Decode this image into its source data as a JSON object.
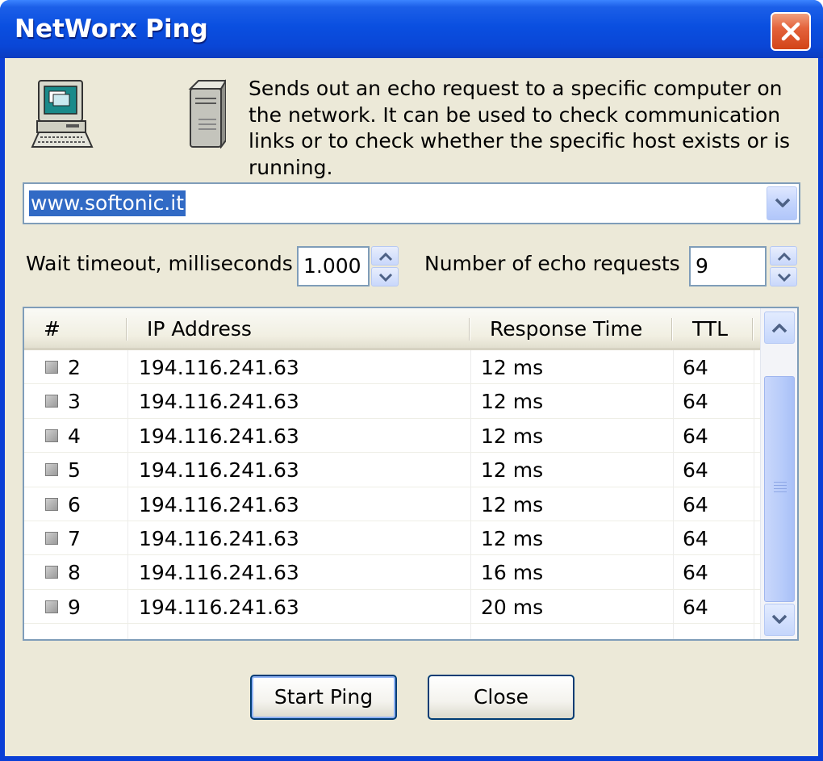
{
  "window": {
    "title": "NetWorx Ping",
    "close_icon": "close-icon"
  },
  "description": "Sends out an echo request to a specific computer on the network. It can be used to check communication links or to check whether the specific host exists or is running.",
  "host_combo": {
    "value": "www.softonic.it"
  },
  "settings": {
    "timeout_label": "Wait timeout, milliseconds",
    "timeout_value": "1.000",
    "count_label": "Number of echo requests",
    "count_value": "9"
  },
  "results": {
    "columns": [
      "#",
      "IP Address",
      "Response Time",
      "TTL"
    ],
    "rows": [
      {
        "num": "2",
        "ip": "194.116.241.63",
        "time": "12 ms",
        "ttl": "64"
      },
      {
        "num": "3",
        "ip": "194.116.241.63",
        "time": "12 ms",
        "ttl": "64"
      },
      {
        "num": "4",
        "ip": "194.116.241.63",
        "time": "12 ms",
        "ttl": "64"
      },
      {
        "num": "5",
        "ip": "194.116.241.63",
        "time": "12 ms",
        "ttl": "64"
      },
      {
        "num": "6",
        "ip": "194.116.241.63",
        "time": "12 ms",
        "ttl": "64"
      },
      {
        "num": "7",
        "ip": "194.116.241.63",
        "time": "12 ms",
        "ttl": "64"
      },
      {
        "num": "8",
        "ip": "194.116.241.63",
        "time": "16 ms",
        "ttl": "64"
      },
      {
        "num": "9",
        "ip": "194.116.241.63",
        "time": "20 ms",
        "ttl": "64"
      }
    ]
  },
  "buttons": {
    "start_label": "Start Ping",
    "close_label": "Close"
  },
  "colors": {
    "titlebar": "#0a4fe0",
    "window_bg": "#ece9d8",
    "selection": "#316ac5",
    "border": "#7f9db9",
    "close_button": "#e4633c"
  }
}
